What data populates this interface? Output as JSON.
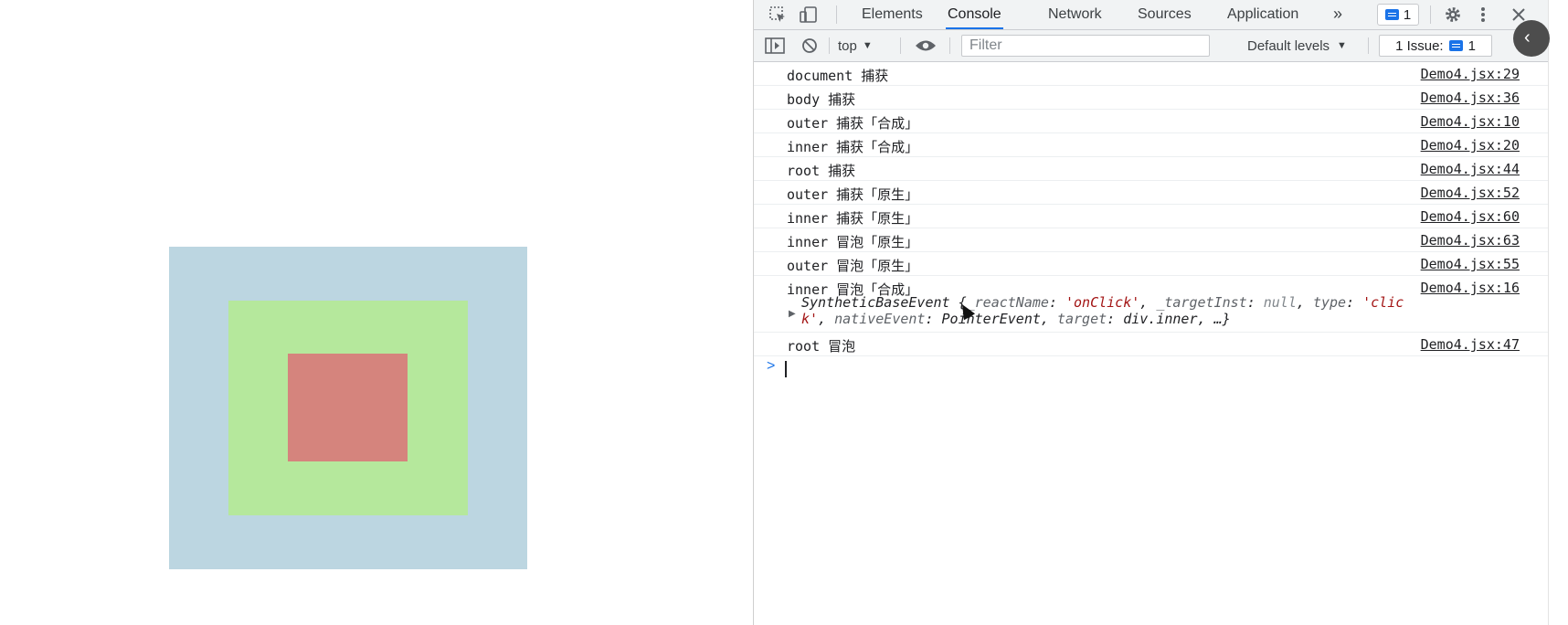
{
  "devtools": {
    "tabs": [
      "Elements",
      "Console",
      "Network",
      "Sources",
      "Application"
    ],
    "active_tab": "Console",
    "more_tabs_glyph": "»",
    "messages_count": "1",
    "toolbar": {
      "context": "top",
      "filter_placeholder": "Filter",
      "levels": "Default levels",
      "issues_label": "1 Issue:",
      "issues_count": "1"
    },
    "console": {
      "rows": [
        {
          "message": "document 捕获",
          "source": "Demo4.jsx:29"
        },
        {
          "message": "body 捕获",
          "source": "Demo4.jsx:36"
        },
        {
          "message": "outer 捕获「合成」",
          "source": "Demo4.jsx:10"
        },
        {
          "message": "inner 捕获「合成」",
          "source": "Demo4.jsx:20"
        },
        {
          "message": "root 捕获",
          "source": "Demo4.jsx:44"
        },
        {
          "message": "outer 捕获「原生」",
          "source": "Demo4.jsx:52"
        },
        {
          "message": "inner 捕获「原生」",
          "source": "Demo4.jsx:60"
        },
        {
          "message": "inner 冒泡「原生」",
          "source": "Demo4.jsx:63"
        },
        {
          "message": "outer 冒泡「原生」",
          "source": "Demo4.jsx:55"
        },
        {
          "message": "inner 冒泡「合成」",
          "source": "Demo4.jsx:16"
        }
      ],
      "object": {
        "class_name": "SyntheticBaseEvent",
        "key_react_name": "_reactName",
        "val_react_name": "'onClick'",
        "key_target_inst": "_targetInst",
        "val_target_inst": "null",
        "key_type": "type",
        "val_type_part1": "'clic",
        "val_type_part2": "k'",
        "key_native_event": "nativeEvent",
        "val_native_event": "PointerEvent",
        "key_target": "target",
        "val_target": "div.inner",
        "ellipsis": "…}"
      },
      "last_row": {
        "message": "root 冒泡",
        "source": "Demo4.jsx:47"
      },
      "prompt_glyph": ">"
    }
  },
  "colors": {
    "outer_box": "#bcd6e1",
    "middle_box": "#b5e89c",
    "inner_box": "#d5847d",
    "accent": "#1a73e8"
  }
}
